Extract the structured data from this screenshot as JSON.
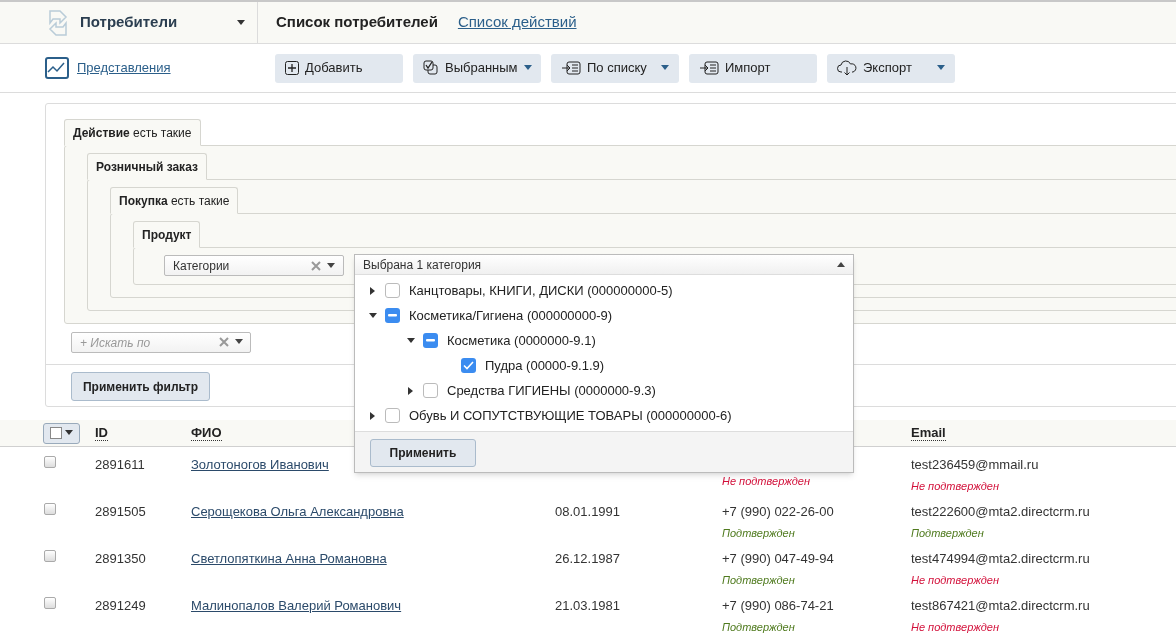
{
  "app_menu": {
    "title": "Потребители"
  },
  "page_tabs": [
    {
      "label": "Список потребителей",
      "selected": true
    },
    {
      "label": "Список действий",
      "selected": false
    }
  ],
  "toolbar": {
    "views_link": "Представления",
    "buttons": [
      {
        "kind": "add",
        "label": "Добавить",
        "dropdown": false
      },
      {
        "kind": "selected",
        "label": "Выбранным",
        "dropdown": true
      },
      {
        "kind": "list",
        "label": "По списку",
        "dropdown": true
      },
      {
        "kind": "import",
        "label": "Импорт",
        "dropdown": false
      },
      {
        "kind": "export",
        "label": "Экспорт",
        "dropdown": true
      }
    ]
  },
  "filter": {
    "condition": {
      "name": "Действие",
      "qualifier": "есть такие",
      "children": [
        {
          "name": "Розничный заказ",
          "children": [
            {
              "name": "Покупка",
              "qualifier": "есть такие",
              "children": [
                {
                  "name": "Продукт",
                  "field": "Категории"
                }
              ]
            }
          ]
        }
      ]
    },
    "search_placeholder": "+ Искать по",
    "apply_button": "Применить фильтр"
  },
  "category_dropdown": {
    "summary": "Выбрана 1 категория",
    "apply_button": "Применить",
    "items": [
      {
        "label": "Канцтовары, КНИГИ, ДИСКИ (000000000-5)",
        "checked": false,
        "indeterminate": false,
        "expanded": false
      },
      {
        "label": "Косметика/Гигиена (000000000-9)",
        "checked": false,
        "indeterminate": true,
        "expanded": true,
        "children": [
          {
            "label": "Косметика (0000000-9.1)",
            "checked": false,
            "indeterminate": true,
            "expanded": true,
            "children": [
              {
                "label": "Пудра (00000-9.1.9)",
                "checked": true,
                "indeterminate": false
              }
            ]
          },
          {
            "label": "Средства ГИГИЕНЫ (0000000-9.3)",
            "checked": false,
            "indeterminate": false,
            "expanded": false
          }
        ]
      },
      {
        "label": "Обувь И СОПУТСТВУЮЩИЕ ТОВАРЫ (000000000-6)",
        "checked": false,
        "indeterminate": false,
        "expanded": false
      }
    ]
  },
  "table": {
    "select_all_checked": false,
    "columns": [
      "ID",
      "ФИО",
      "Email"
    ],
    "rows": [
      {
        "checked": false,
        "id": "2891611",
        "name": "Золотоногов Иванович",
        "phone_status": {
          "text": "Не подтвержден",
          "confirmed": false
        },
        "email": "test236459@mmail.ru",
        "email_status": {
          "text": "Не подтвержден",
          "confirmed": false
        }
      },
      {
        "checked": false,
        "id": "2891505",
        "name": "Серощекова Ольга Александровна",
        "birth_date": "08.01.1991",
        "phone": "+7 (990) 022-26-00",
        "phone_status": {
          "text": "Подтвержден",
          "confirmed": true
        },
        "email": "test222600@mta2.directcrm.ru",
        "email_status": {
          "text": "Подтвержден",
          "confirmed": true
        }
      },
      {
        "checked": false,
        "id": "2891350",
        "name": "Светлопяткина Анна Романовна",
        "birth_date": "26.12.1987",
        "phone": "+7 (990) 047-49-94",
        "phone_status": {
          "text": "Подтвержден",
          "confirmed": true
        },
        "email": "test474994@mta2.directcrm.ru",
        "email_status": {
          "text": "Не подтвержден",
          "confirmed": false
        }
      },
      {
        "checked": false,
        "id": "2891249",
        "name": "Малинопалов Валерий Романович",
        "birth_date": "21.03.1981",
        "phone": "+7 (990) 086-74-21",
        "phone_status": {
          "text": "Подтвержден",
          "confirmed": true
        },
        "email": "test867421@mta2.directcrm.ru",
        "email_status": {
          "text": "Не подтвержден",
          "confirmed": false
        }
      }
    ]
  }
}
